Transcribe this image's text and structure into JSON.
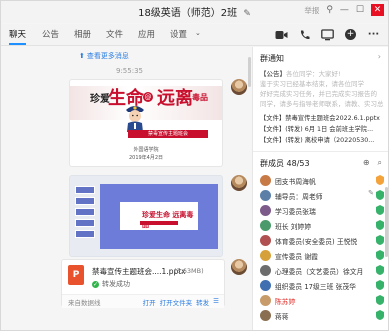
{
  "window": {
    "title": "18级英语（师范）2班",
    "report_label": "举报"
  },
  "tabs": [
    "聊天",
    "公告",
    "相册",
    "文件",
    "应用",
    "设置"
  ],
  "chat": {
    "new_messages_link": "查看更多消息",
    "timestamp": "9:55:35",
    "poster": {
      "left_text": "珍爱",
      "big_text_1": "生命",
      "circle_text": "@",
      "big_text_2": "远离",
      "end_text": "毒品",
      "red_banner": "禁毒宣传主题班会",
      "sub_line_1": "外国语学院",
      "sub_line_2": "2019年4月2日"
    },
    "slide": {
      "title": "珍爱生命 远离毒品"
    },
    "file": {
      "icon_letter": "P",
      "name": "禁毒宣传主题班会....1.pptx",
      "size": "(3.63MB)",
      "status": "转发成功",
      "source": "来自数据线",
      "actions": [
        "打开",
        "打开文件夹",
        "转发"
      ]
    }
  },
  "side": {
    "notice_title": "群通知",
    "notice_lines": [
      {
        "tag": "【公告】",
        "text": "各位同学：大家好!"
      },
      {
        "tag": "",
        "text": "    鉴于实习已经基本结束，请各位同学"
      },
      {
        "tag": "",
        "text": "好好完成实习任务，并已完成实习报告的"
      },
      {
        "tag": "",
        "text": "同学，请多与指导老师联系，请教、实习总"
      }
    ],
    "file_lines": [
      {
        "tag": "【文件】",
        "name": "禁毒宣传主题班会2022.6.1.pptx",
        "muted": ""
      },
      {
        "tag": "【文件】",
        "name": "(转发)  6月 1日 会前班主学院...",
        "muted": ""
      },
      {
        "tag": "【文件】",
        "name": "(转发)  离校申请（20220530...",
        "muted": ""
      }
    ],
    "members_title": "群成员 48/53",
    "members": [
      {
        "name": "团支书周海帆",
        "color": "#c77a46",
        "red": false,
        "role": "owner"
      },
      {
        "name": "辅导员：周老师",
        "color": "#5c7fa8",
        "red": false,
        "role": "admin"
      },
      {
        "name": "学习委员张瑞",
        "color": "#7c5b8a",
        "red": false,
        "role": "admin"
      },
      {
        "name": "班长 刘婷婷",
        "color": "#4a9a6b",
        "red": false,
        "role": "admin"
      },
      {
        "name": "体育委员(安全委员) 王悦悦",
        "color": "#b05050",
        "red": false,
        "role": "admin"
      },
      {
        "name": "宣传委员 谢霞",
        "color": "#d6a13a",
        "red": false,
        "role": "admin"
      },
      {
        "name": "心理委员（文艺委员）徐文月",
        "color": "#6d6d6d",
        "red": false,
        "role": "admin"
      },
      {
        "name": "组织委员 17级三班 张茂华",
        "color": "#3f6fb0",
        "red": false,
        "role": "admin"
      },
      {
        "name": "陈苏婷",
        "color": "#c89b6a",
        "red": true,
        "role": "admin"
      },
      {
        "name": "蒋蒋",
        "color": "#8a6e52",
        "red": false,
        "role": "admin"
      }
    ]
  },
  "colors": {
    "accent": "#1e90ff",
    "link": "#2b7de1",
    "poster_red": "#c8102e",
    "close": "#e81123"
  }
}
